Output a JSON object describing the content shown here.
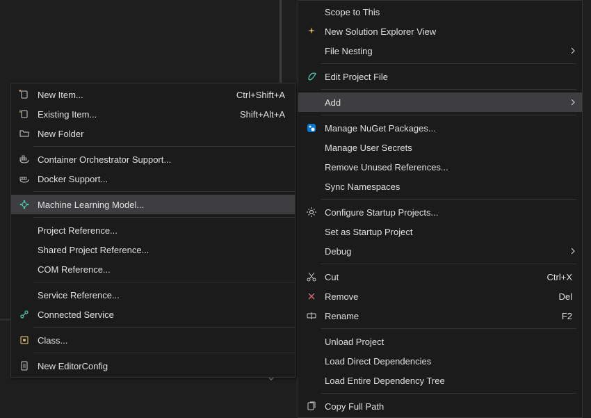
{
  "mainMenu": {
    "scopeToThis": "Scope to This",
    "newSolutionExplorer": "New Solution Explorer View",
    "fileNesting": "File Nesting",
    "editProjectFile": "Edit Project File",
    "add": "Add",
    "manageNuget": "Manage NuGet Packages...",
    "manageUserSecrets": "Manage User Secrets",
    "removeUnused": "Remove Unused References...",
    "syncNamespaces": "Sync Namespaces",
    "configureStartup": "Configure Startup Projects...",
    "setStartup": "Set as Startup Project",
    "debug": "Debug",
    "cut": "Cut",
    "cutShortcut": "Ctrl+X",
    "remove": "Remove",
    "removeShortcut": "Del",
    "rename": "Rename",
    "renameShortcut": "F2",
    "unloadProject": "Unload Project",
    "loadDirect": "Load Direct Dependencies",
    "loadEntire": "Load Entire Dependency Tree",
    "copyFullPath": "Copy Full Path"
  },
  "subMenu": {
    "newItem": "New Item...",
    "newItemShortcut": "Ctrl+Shift+A",
    "existingItem": "Existing Item...",
    "existingItemShortcut": "Shift+Alt+A",
    "newFolder": "New Folder",
    "containerOrch": "Container Orchestrator Support...",
    "dockerSupport": "Docker Support...",
    "mlModel": "Machine Learning Model...",
    "projectReference": "Project Reference...",
    "sharedProjectReference": "Shared Project Reference...",
    "comReference": "COM Reference...",
    "serviceReference": "Service Reference...",
    "connectedService": "Connected Service",
    "class": "Class...",
    "newEditorConfig": "New EditorConfig"
  }
}
